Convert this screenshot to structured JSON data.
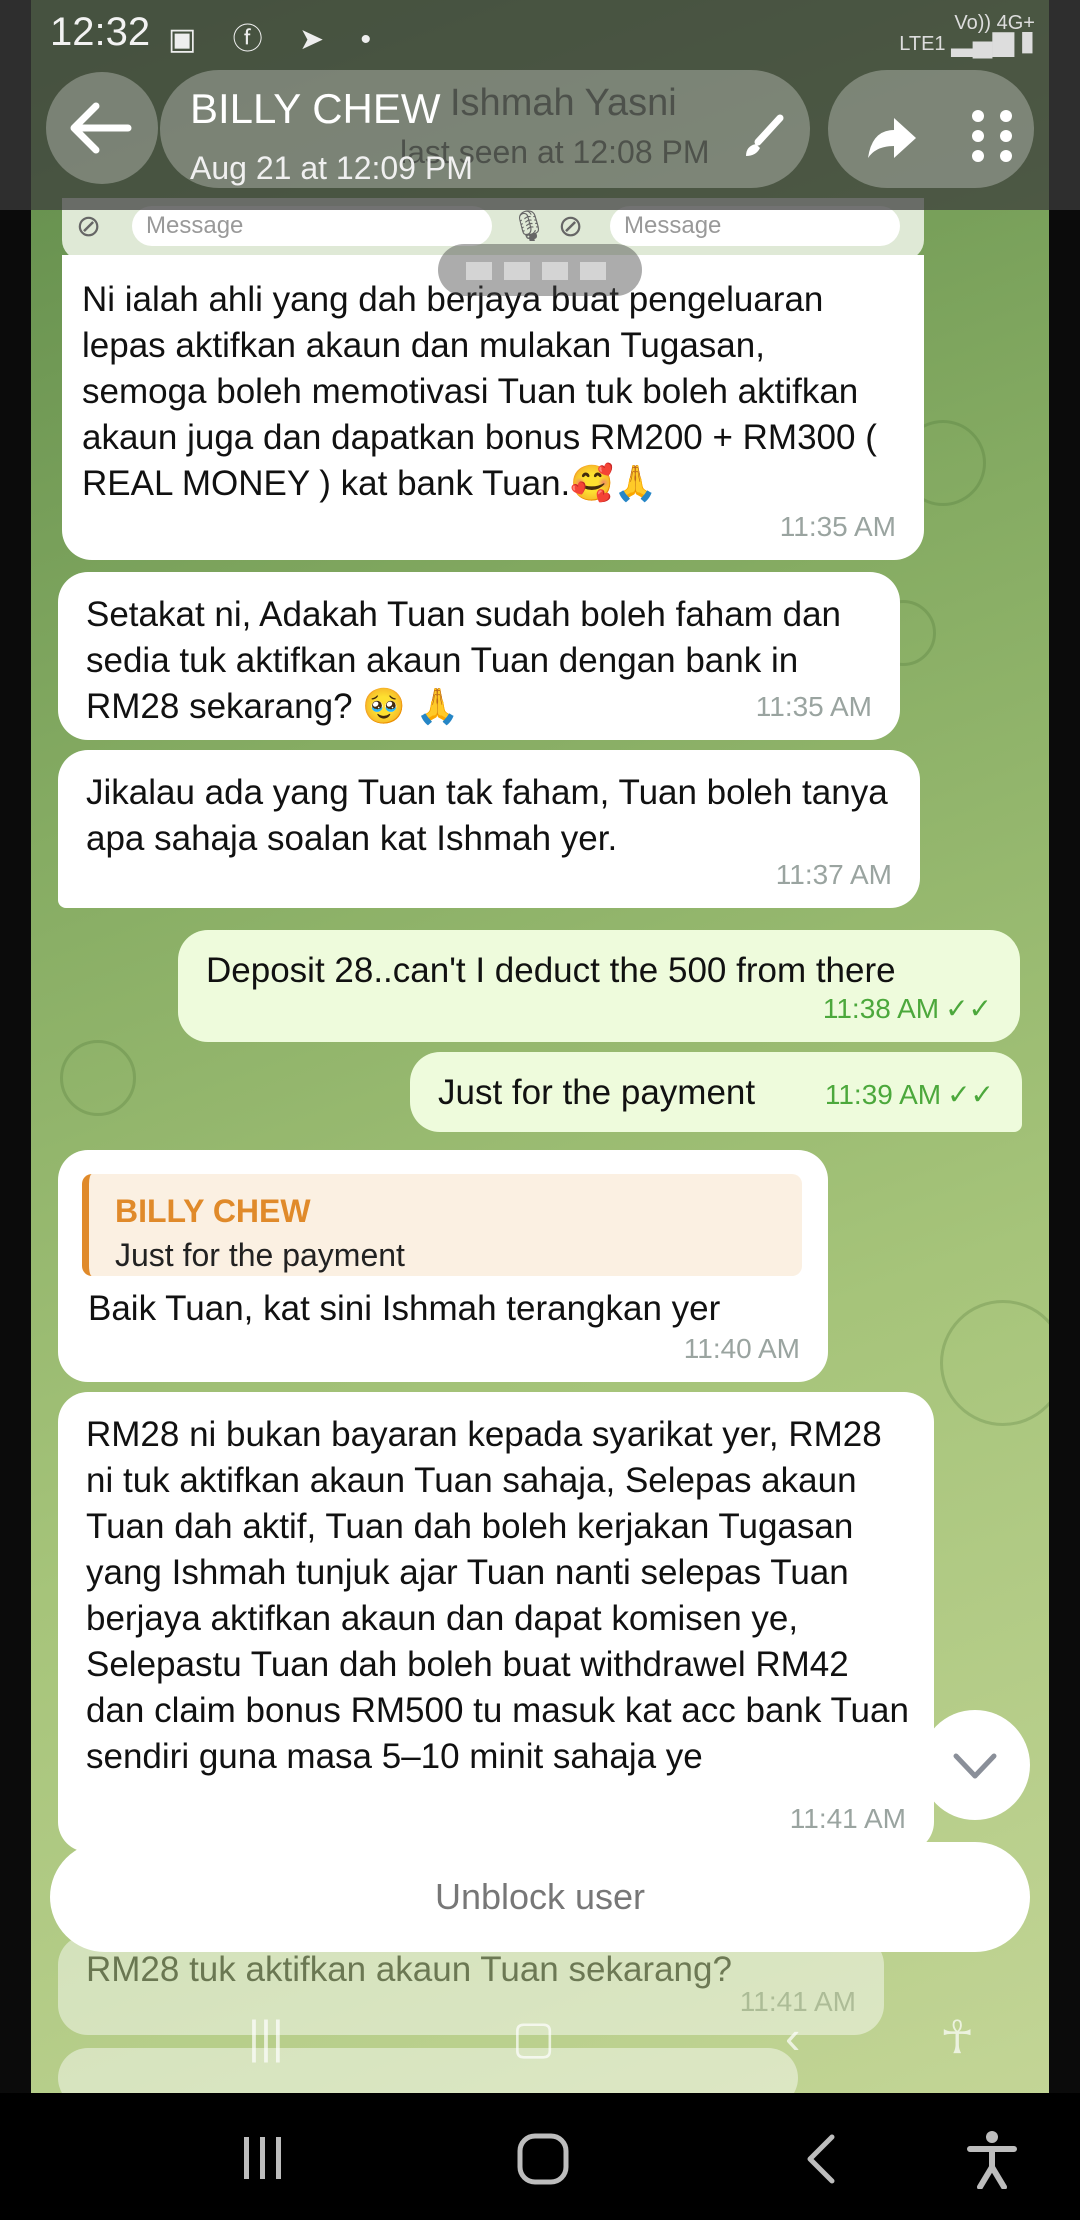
{
  "status_bar": {
    "time": "12:32",
    "network": "Vo)) 4G+",
    "network_sub": "LTE1"
  },
  "header": {
    "title": "BILLY CHEW",
    "subtitle": "Aug 21 at 12:09 PM",
    "ghost_name": "Ishmah Yasni",
    "ghost_seen": "last seen at 12:08 PM"
  },
  "preview_inputs": {
    "placeholder_left": "Message",
    "placeholder_right": "Message"
  },
  "messages": [
    {
      "dir": "in",
      "text": "Ni ialah ahli yang dah berjaya buat pengeluaran lepas aktifkan akaun dan mulakan Tugasan, semoga boleh memotivasi Tuan tuk boleh aktifkan akaun juga dan dapatkan bonus RM200 + RM300 ( REAL MONEY ) kat bank Tuan.🥰🙏",
      "time": "11:35 AM"
    },
    {
      "dir": "in",
      "text": "Setakat ni, Adakah Tuan sudah boleh faham dan sedia tuk aktifkan akaun Tuan dengan bank in RM28 sekarang? 🥹 🙏",
      "time": "11:35 AM"
    },
    {
      "dir": "in",
      "text": "Jikalau ada yang Tuan tak faham, Tuan boleh tanya apa sahaja soalan kat Ishmah yer.",
      "time": "11:37 AM"
    },
    {
      "dir": "out",
      "text": "Deposit 28..can't I deduct the 500 from there",
      "time": "11:38 AM"
    },
    {
      "dir": "out",
      "text": "Just for the payment",
      "time": "11:39 AM"
    },
    {
      "dir": "in",
      "quote_name": "BILLY CHEW",
      "quote_text": "Just for the payment",
      "text": "Baik Tuan, kat sini Ishmah terangkan yer",
      "time": "11:40 AM"
    },
    {
      "dir": "in",
      "text": "RM28 ni bukan bayaran kepada syarikat yer, RM28 ni tuk aktifkan akaun Tuan sahaja, Selepas akaun Tuan dah aktif, Tuan dah boleh kerjakan Tugasan yang Ishmah tunjuk ajar Tuan nanti selepas Tuan berjaya aktifkan akaun dan dapat komisen ye, Selepastu Tuan dah boleh buat withdrawel RM42 dan claim bonus RM500 tu masuk kat acc bank Tuan sendiri guna masa 5–10 minit sahaja ye",
      "time": "11:41 AM"
    },
    {
      "dir": "in",
      "text": "RM28 tuk aktifkan akaun Tuan sekarang?",
      "time": "11:41 AM"
    }
  ],
  "checks": "✓✓",
  "unblock_label": "Unblock user",
  "icons": [
    "back-arrow-icon",
    "brush-icon",
    "forward-icon",
    "more-icon",
    "attach-icon",
    "sticker-icon",
    "mic-icon",
    "scroll-down-icon",
    "recent-apps-icon",
    "home-icon",
    "nav-back-icon",
    "accessibility-icon"
  ]
}
